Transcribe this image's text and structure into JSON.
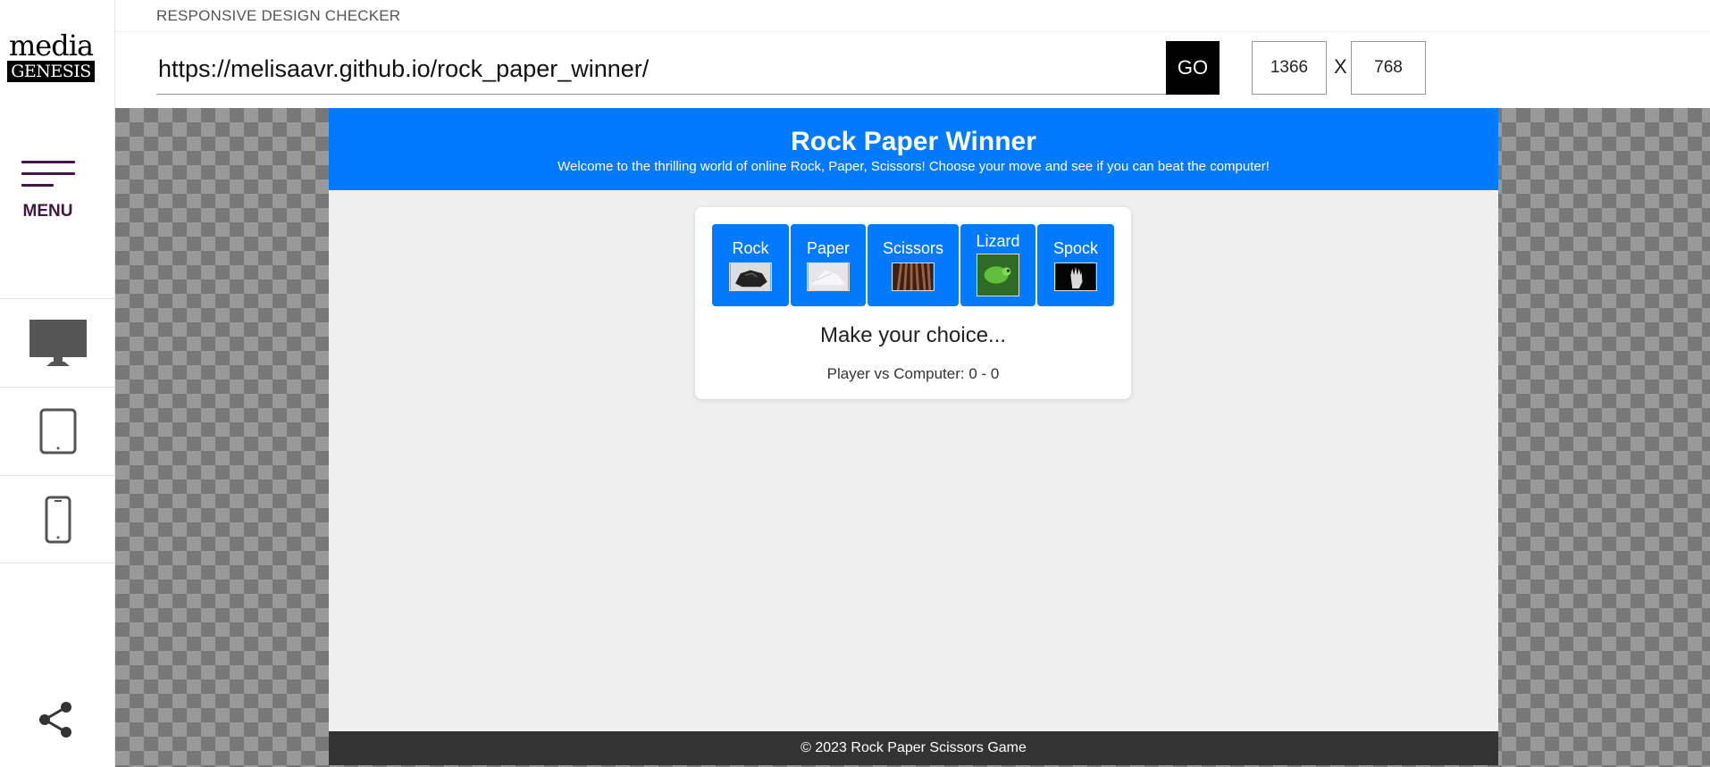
{
  "checker": {
    "title": "RESPONSIVE DESIGN CHECKER",
    "url": "https://melisaavr.github.io/rock_paper_winner/",
    "go_label": "GO",
    "width": "1366",
    "height": "768",
    "x_label": "X"
  },
  "logo": {
    "top": "media",
    "bottom": "GENESIS"
  },
  "sidebar": {
    "menu_label": "MENU",
    "devices": [
      "desktop-icon",
      "tablet-icon",
      "phone-icon"
    ],
    "share_icon": "share-icon"
  },
  "site": {
    "title": "Rock Paper Winner",
    "subtitle": "Welcome to the thrilling world of online Rock, Paper, Scissors! Choose your move and see if you can beat the computer!",
    "choices": [
      {
        "label": "Rock"
      },
      {
        "label": "Paper"
      },
      {
        "label": "Scissors"
      },
      {
        "label": "Lizard"
      },
      {
        "label": "Spock"
      }
    ],
    "message": "Make your choice...",
    "score": "Player vs Computer: 0 - 0",
    "footer": "© 2023 Rock Paper Scissors Game"
  },
  "colors": {
    "accent": "#007bff",
    "menu": "#3f1746",
    "footer": "#333333"
  }
}
